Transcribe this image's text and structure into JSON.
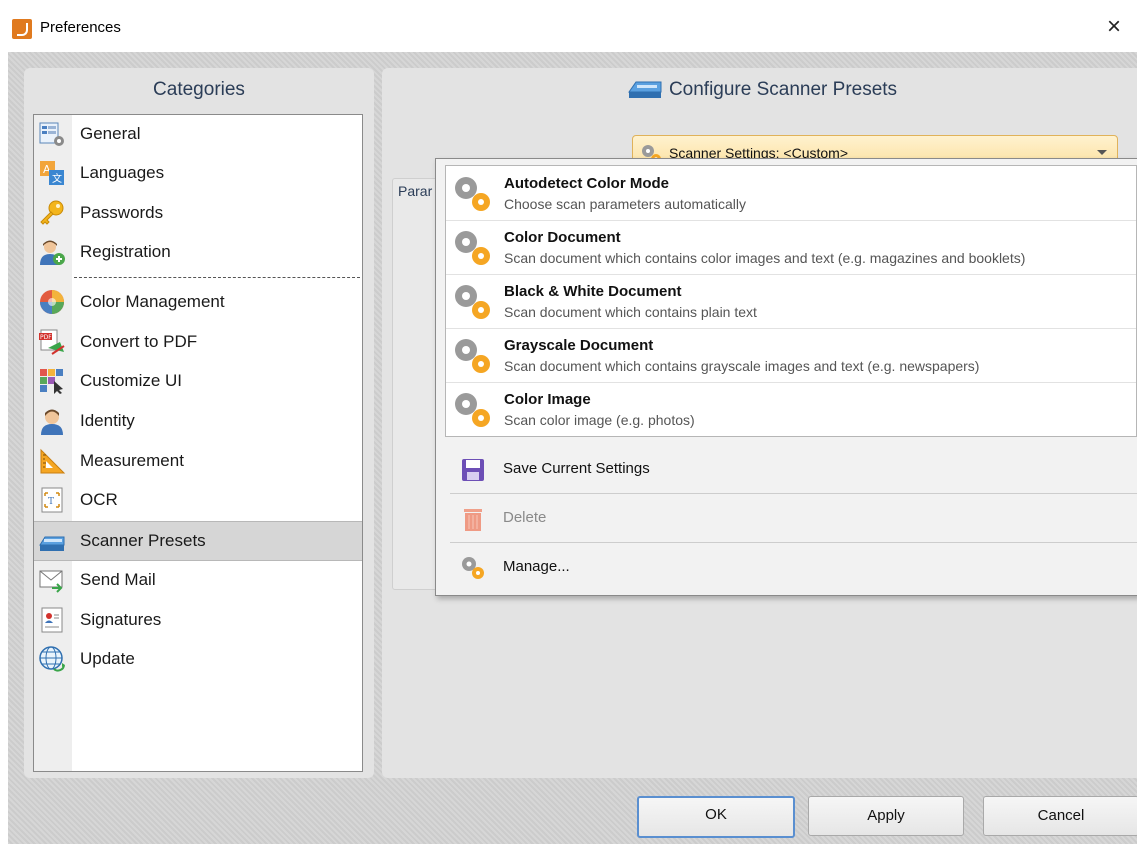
{
  "window": {
    "title": "Preferences",
    "close_glyph": "×"
  },
  "categories_panel": {
    "header": "Categories",
    "items": [
      {
        "label": "General",
        "icon": "general-settings-icon"
      },
      {
        "label": "Languages",
        "icon": "languages-icon"
      },
      {
        "label": "Passwords",
        "icon": "key-icon"
      },
      {
        "label": "Registration",
        "icon": "user-add-icon"
      },
      {
        "label": "Color Management",
        "icon": "color-wheel-icon"
      },
      {
        "label": "Convert to PDF",
        "icon": "convert-pdf-icon"
      },
      {
        "label": "Customize UI",
        "icon": "customize-ui-icon"
      },
      {
        "label": "Identity",
        "icon": "person-icon"
      },
      {
        "label": "Measurement",
        "icon": "triangle-ruler-icon"
      },
      {
        "label": "OCR",
        "icon": "ocr-icon"
      },
      {
        "label": "Scanner Presets",
        "icon": "scanner-icon",
        "selected": true
      },
      {
        "label": "Send Mail",
        "icon": "mail-icon"
      },
      {
        "label": "Signatures",
        "icon": "signature-icon"
      },
      {
        "label": "Update",
        "icon": "globe-update-icon"
      }
    ]
  },
  "scanner_panel": {
    "header": "Configure Scanner Presets",
    "combo_label": "Scanner Settings:",
    "combo_value": "<Custom>",
    "params_label": "Parar"
  },
  "dropdown": {
    "presets": [
      {
        "title": "Autodetect Color Mode",
        "description": "Choose scan parameters automatically"
      },
      {
        "title": "Color Document",
        "description": "Scan document which contains color images and text (e.g. magazines and booklets)"
      },
      {
        "title": "Black & White Document",
        "description": "Scan document which contains plain text"
      },
      {
        "title": "Grayscale Document",
        "description": "Scan document which contains grayscale images and text (e.g. newspapers)"
      },
      {
        "title": "Color Image",
        "description": "Scan color image (e.g. photos)"
      }
    ],
    "actions": [
      {
        "label": "Save Current Settings",
        "icon": "save-icon",
        "enabled": true
      },
      {
        "label": "Delete",
        "icon": "trash-icon",
        "enabled": false
      },
      {
        "label": "Manage...",
        "icon": "gears-icon",
        "enabled": true
      }
    ]
  },
  "buttons": {
    "ok": "OK",
    "apply": "Apply",
    "cancel": "Cancel"
  },
  "colors": {
    "accent_combo": "#fbdf9c",
    "selected_item": "#d6d6d6",
    "header_text": "#2b3d57"
  }
}
